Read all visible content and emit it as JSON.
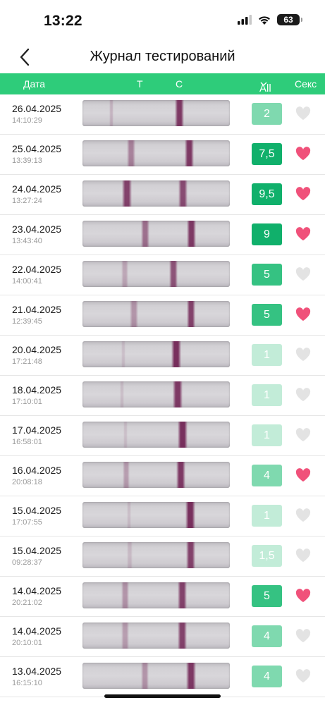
{
  "status_bar": {
    "time": "13:22",
    "battery": "63"
  },
  "nav": {
    "title": "Журнал тестирований"
  },
  "table_header": {
    "date": "Дата",
    "t": "Т",
    "c": "С",
    "filter": "All",
    "sex": "Секс"
  },
  "colors": {
    "header_green": "#2ecc7a",
    "heart_active": "#f0517a",
    "heart_inactive": "#e3e3e3",
    "badge_dark": "#10b06b",
    "badge_mid": "#35c282",
    "badge_light": "#7fd9af",
    "badge_faint": "#c2ecd8"
  },
  "entries": [
    {
      "date": "26.04.2025",
      "time": "14:10:29",
      "value": "2",
      "sex": false
    },
    {
      "date": "25.04.2025",
      "time": "13:39:13",
      "value": "7,5",
      "sex": true
    },
    {
      "date": "24.04.2025",
      "time": "13:27:24",
      "value": "9,5",
      "sex": true
    },
    {
      "date": "23.04.2025",
      "time": "13:43:40",
      "value": "9",
      "sex": true
    },
    {
      "date": "22.04.2025",
      "time": "14:00:41",
      "value": "5",
      "sex": false
    },
    {
      "date": "21.04.2025",
      "time": "12:39:45",
      "value": "5",
      "sex": true
    },
    {
      "date": "20.04.2025",
      "time": "17:21:48",
      "value": "1",
      "sex": false
    },
    {
      "date": "18.04.2025",
      "time": "17:10:01",
      "value": "1",
      "sex": false
    },
    {
      "date": "17.04.2025",
      "time": "16:58:01",
      "value": "1",
      "sex": false
    },
    {
      "date": "16.04.2025",
      "time": "20:08:18",
      "value": "4",
      "sex": true
    },
    {
      "date": "15.04.2025",
      "time": "17:07:55",
      "value": "1",
      "sex": false
    },
    {
      "date": "15.04.2025",
      "time": "09:28:37",
      "value": "1,5",
      "sex": false
    },
    {
      "date": "14.04.2025",
      "time": "20:21:02",
      "value": "5",
      "sex": true
    },
    {
      "date": "14.04.2025",
      "time": "20:10:01",
      "value": "4",
      "sex": false
    },
    {
      "date": "13.04.2025",
      "time": "16:15:10",
      "value": "4",
      "sex": false
    }
  ]
}
